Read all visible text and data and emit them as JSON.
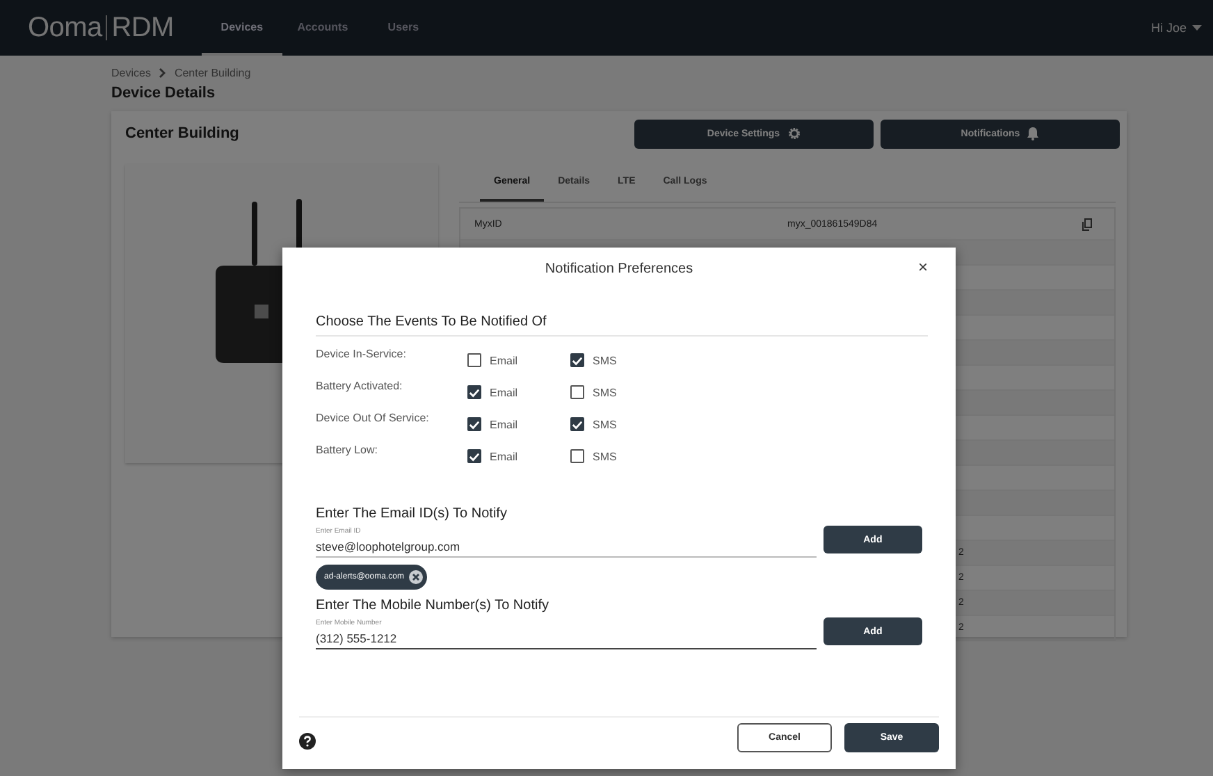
{
  "nav": {
    "logo": "Ooma",
    "logo_suffix": "RDM",
    "tabs": [
      {
        "label": "Devices",
        "selected": true
      },
      {
        "label": "Accounts",
        "selected": false
      },
      {
        "label": "Users",
        "selected": false
      }
    ],
    "user": "Hi Joe"
  },
  "breadcrumb": [
    "Devices",
    "Center Building"
  ],
  "page_title": "Device Details",
  "card": {
    "title": "Center Building",
    "buttons": [
      {
        "label": "Device Settings",
        "kind": "gear"
      },
      {
        "label": "Notifications",
        "kind": "bell"
      }
    ],
    "tabs": [
      {
        "label": "General",
        "selected": true
      },
      {
        "label": "Details",
        "selected": false
      },
      {
        "label": "LTE",
        "selected": false
      },
      {
        "label": "Call Logs",
        "selected": false
      }
    ],
    "rows": [
      {
        "label": "MyxID",
        "value": "myx_001861549D84",
        "copyable": true
      },
      {},
      {},
      {},
      {},
      {},
      {},
      {},
      {},
      {},
      {},
      {},
      {},
      {
        "value": "2"
      },
      {
        "value": "2"
      },
      {
        "value": "2"
      },
      {
        "value": "2"
      }
    ]
  },
  "dialog": {
    "title": "Notification Preferences",
    "close": "×",
    "events_heading": "Choose The Events To Be Notified Of",
    "events": [
      {
        "label": "Device In-Service:",
        "options": [
          {
            "label": "Email",
            "checked": false
          },
          {
            "label": "SMS",
            "checked": true
          }
        ]
      },
      {
        "label": "Battery Activated:",
        "options": [
          {
            "label": "Email",
            "checked": true
          },
          {
            "label": "SMS",
            "checked": false
          }
        ]
      },
      {
        "label": "Device Out Of Service:",
        "options": [
          {
            "label": "Email",
            "checked": true
          },
          {
            "label": "SMS",
            "checked": true
          }
        ]
      },
      {
        "label": "Battery Low:",
        "options": [
          {
            "label": "Email",
            "checked": true
          },
          {
            "label": "SMS",
            "checked": false
          }
        ]
      }
    ],
    "sections": [
      {
        "kind": "email",
        "heading": "Enter The Email ID(s) To Notify",
        "field_label": "Enter Email ID",
        "value": "steve@loophotelgroup.com",
        "button": "Add",
        "chips": [
          "ad-alerts@ooma.com"
        ]
      },
      {
        "kind": "mobile",
        "heading": "Enter The Mobile Number(s) To Notify",
        "field_label": "Enter Mobile Number",
        "value": "(312) 555-1212",
        "button": "Add"
      }
    ],
    "buttons": [
      {
        "label": "Cancel",
        "kind": "secondary"
      },
      {
        "label": "Save",
        "kind": "primary"
      }
    ]
  }
}
